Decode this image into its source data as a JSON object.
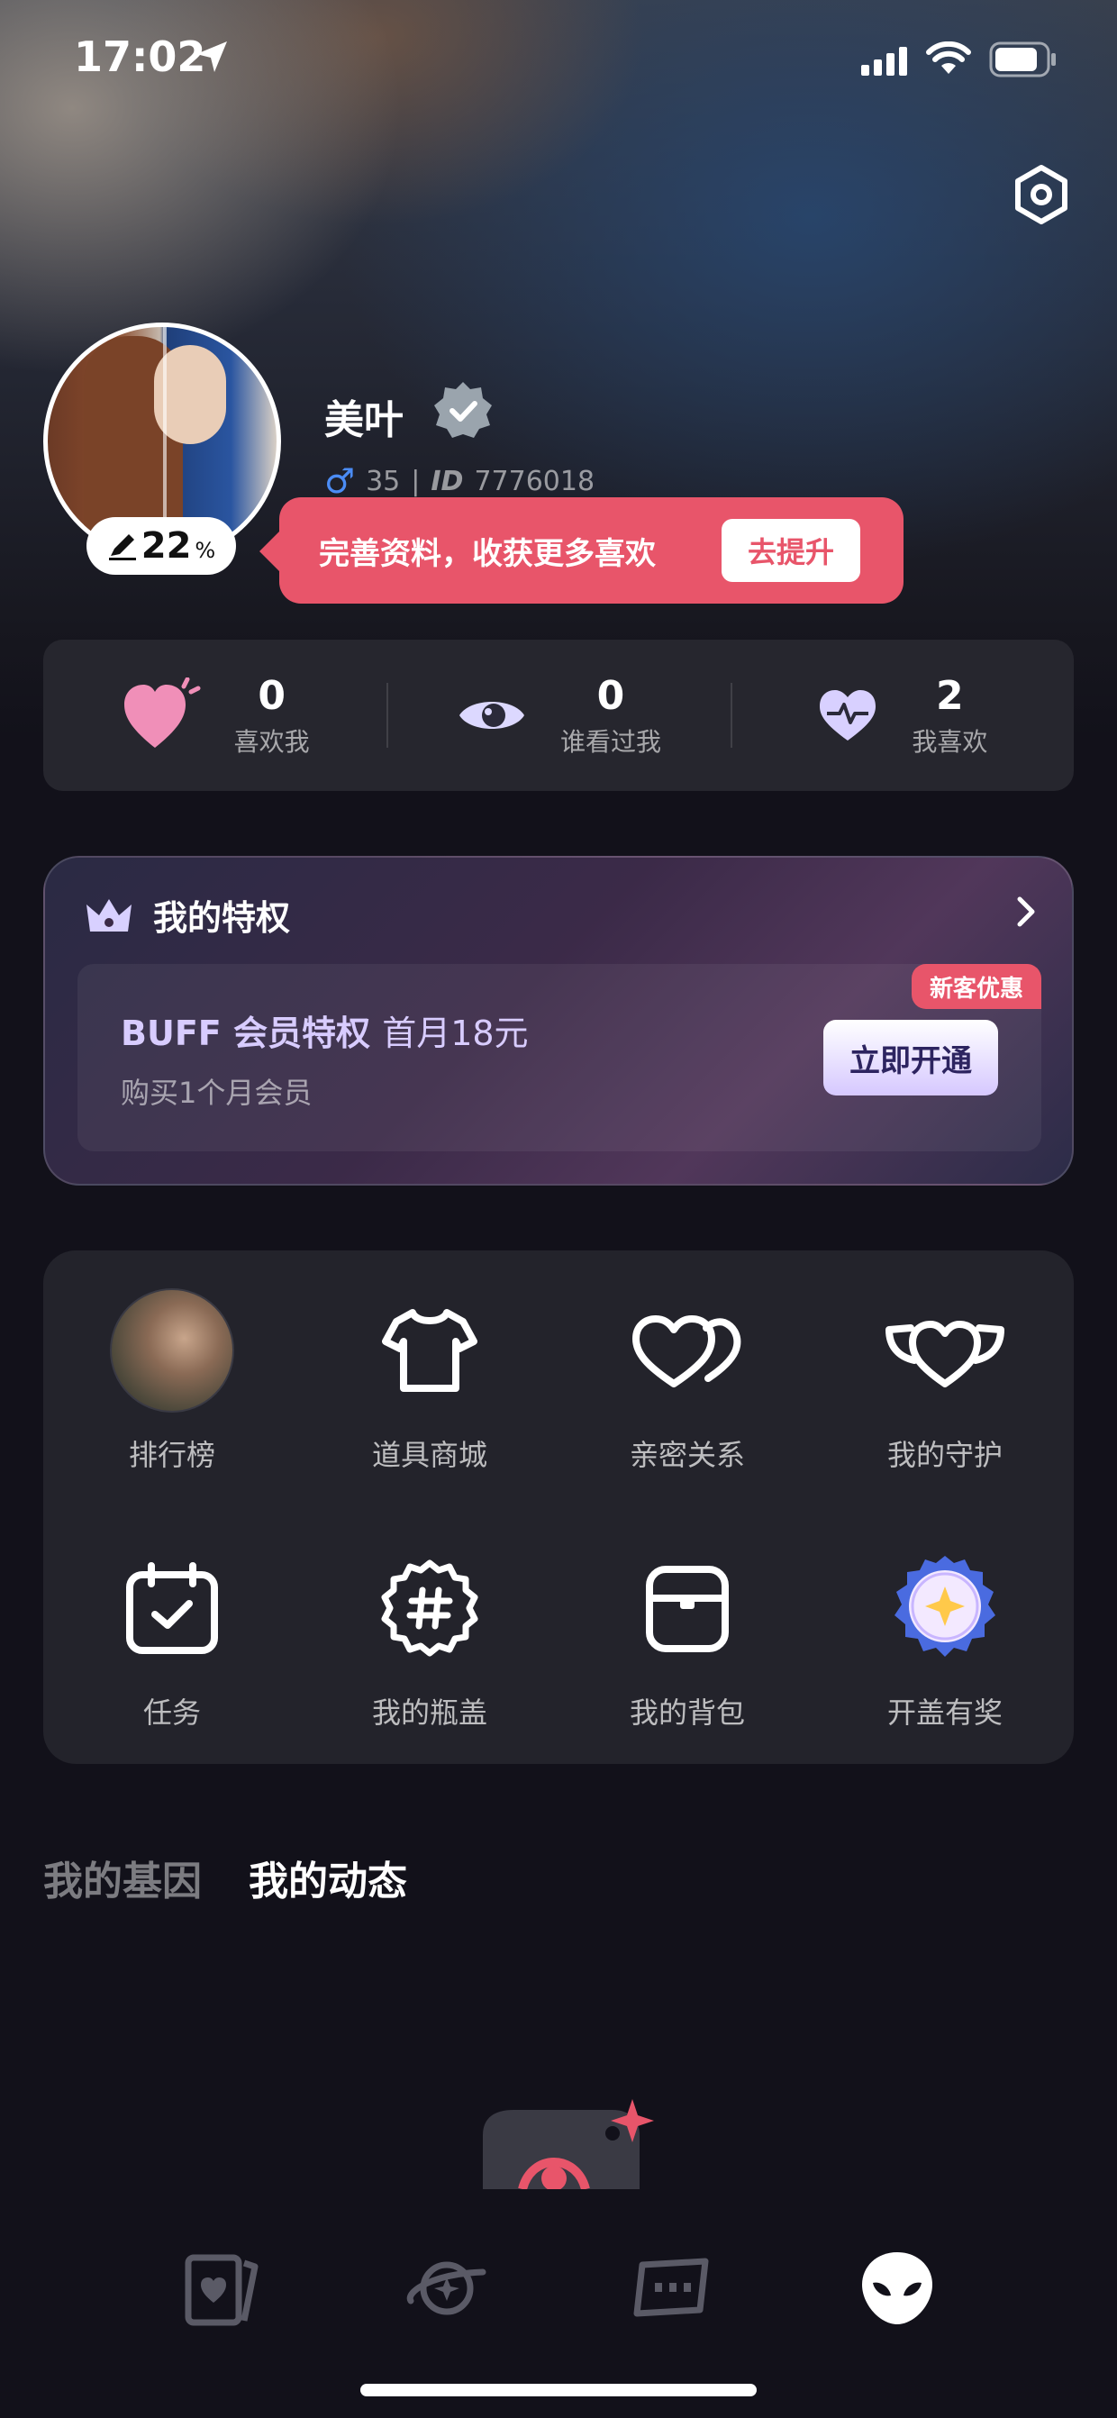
{
  "status_bar": {
    "time": "17:02"
  },
  "profile": {
    "name": "美叶",
    "gender_symbol": "♂",
    "age": "35",
    "separator": "|",
    "id_label": "ID",
    "id_value": "7776018",
    "completion_value": "22",
    "completion_unit": "%",
    "completion_fraction": 0.22
  },
  "tip": {
    "text": "完善资料，收获更多喜欢",
    "button": "去提升"
  },
  "stats": [
    {
      "count": "0",
      "label": "喜欢我",
      "icon": "heart-icon"
    },
    {
      "count": "0",
      "label": "谁看过我",
      "icon": "eye-icon"
    },
    {
      "count": "2",
      "label": "我喜欢",
      "icon": "heartbeat-icon"
    }
  ],
  "privilege": {
    "title": "我的特权",
    "vip_title": "BUFF 会员特权",
    "vip_price": "首月18元",
    "vip_sub": "购买1个月会员",
    "button": "立即开通",
    "badge": "新客优惠"
  },
  "grid": [
    {
      "label": "排行榜",
      "icon": "ranking-photo"
    },
    {
      "label": "道具商城",
      "icon": "shirt-icon"
    },
    {
      "label": "亲密关系",
      "icon": "double-heart-icon"
    },
    {
      "label": "我的守护",
      "icon": "guard-heart-icon"
    },
    {
      "label": "任务",
      "icon": "calendar-check-icon"
    },
    {
      "label": "我的瓶盖",
      "icon": "bottle-cap-icon"
    },
    {
      "label": "我的背包",
      "icon": "backpack-icon"
    },
    {
      "label": "开盖有奖",
      "icon": "prize-cap-icon"
    }
  ],
  "tabs": [
    {
      "label": "我的基因",
      "active": false
    },
    {
      "label": "我的动态",
      "active": true
    }
  ],
  "bottom_nav": [
    "cards-icon",
    "planet-icon",
    "chat-icon",
    "alien-icon"
  ],
  "colors": {
    "accent": "#e8556a",
    "vip": "#d8ccff",
    "background": "#12111a"
  }
}
